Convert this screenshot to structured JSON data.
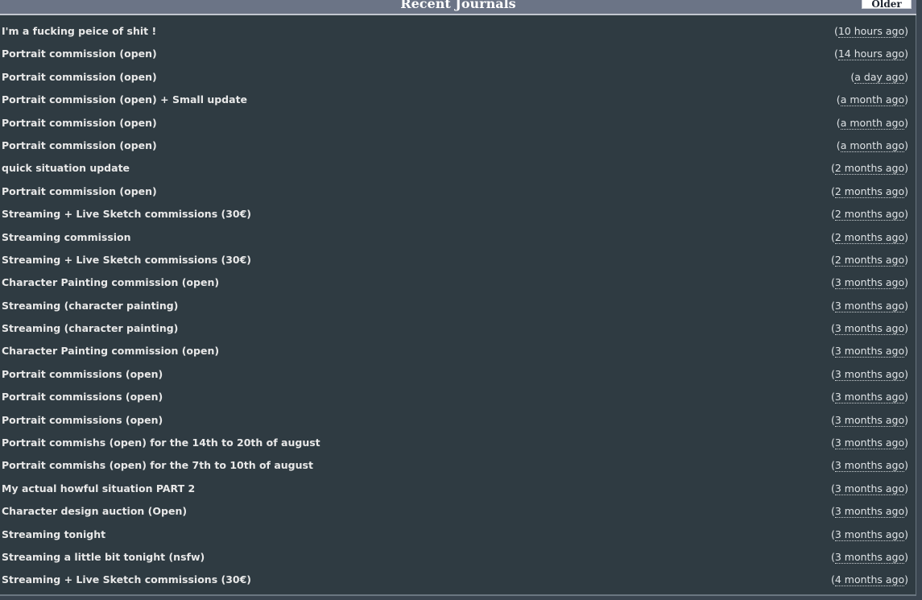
{
  "header": {
    "title": "Recent Journals",
    "older_label": "Older"
  },
  "journals": [
    {
      "title": "I'm a fucking peice of shit !",
      "time": "10 hours ago"
    },
    {
      "title": "Portrait commission (open)",
      "time": "14 hours ago"
    },
    {
      "title": "Portrait commission (open)",
      "time": "a day ago"
    },
    {
      "title": "Portrait commission (open) + Small update",
      "time": "a month ago"
    },
    {
      "title": "Portrait commission (open)",
      "time": "a month ago"
    },
    {
      "title": "Portrait commission (open)",
      "time": "a month ago"
    },
    {
      "title": "quick situation update",
      "time": "2 months ago"
    },
    {
      "title": "Portrait commission (open)",
      "time": "2 months ago"
    },
    {
      "title": "Streaming + Live Sketch commissions (30€)",
      "time": "2 months ago"
    },
    {
      "title": "Streaming commission",
      "time": "2 months ago"
    },
    {
      "title": "Streaming + Live Sketch commissions (30€)",
      "time": "2 months ago"
    },
    {
      "title": "Character Painting commission (open)",
      "time": "3 months ago"
    },
    {
      "title": "Streaming (character painting)",
      "time": "3 months ago"
    },
    {
      "title": "Streaming (character painting)",
      "time": "3 months ago"
    },
    {
      "title": "Character Painting commission (open)",
      "time": "3 months ago"
    },
    {
      "title": "Portrait commissions (open)",
      "time": "3 months ago"
    },
    {
      "title": "Portrait commissions (open)",
      "time": "3 months ago"
    },
    {
      "title": "Portrait commissions (open)",
      "time": "3 months ago"
    },
    {
      "title": "Portrait commishs (open) for the 14th to 20th of august",
      "time": "3 months ago"
    },
    {
      "title": "Portrait commishs (open) for the 7th to 10th of august",
      "time": "3 months ago"
    },
    {
      "title": "My actual howful situation PART 2",
      "time": "3 months ago"
    },
    {
      "title": "Character design auction (Open)",
      "time": "3 months ago"
    },
    {
      "title": "Streaming tonight",
      "time": "3 months ago"
    },
    {
      "title": "Streaming a little bit tonight (nsfw)",
      "time": "3 months ago"
    },
    {
      "title": "Streaming + Live Sketch commissions (30€)",
      "time": "4 months ago"
    }
  ]
}
